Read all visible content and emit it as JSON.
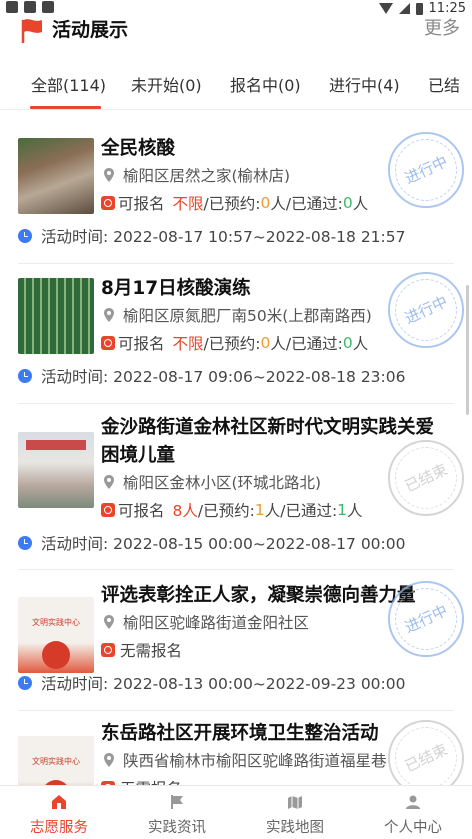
{
  "status_bar": {
    "time": "11:25"
  },
  "header": {
    "title": "活动展示",
    "more_label": "更多"
  },
  "tabs": [
    {
      "label": "全部(114)",
      "active": true
    },
    {
      "label": "未开始(0)",
      "active": false
    },
    {
      "label": "报名中(0)",
      "active": false
    },
    {
      "label": "进行中(4)",
      "active": false
    },
    {
      "label": "已结",
      "active": false
    }
  ],
  "activities": [
    {
      "title": "全民核酸",
      "location": "榆阳区居然之家(榆林店)",
      "reg_prefix": "可报名",
      "reg_limit": "不限",
      "reg_mid1": "/已预约: ",
      "reg_booked": "0",
      "reg_mid2": "人/已通过: ",
      "reg_passed": "0",
      "reg_suffix": "人",
      "time": "活动时间: 2022-08-17 10:57~2022-08-18 21:57",
      "stamp": "进行中"
    },
    {
      "title": "8月17日核酸演练",
      "location": "榆阳区原氮肥厂南50米(上郡南路西)",
      "reg_prefix": "可报名",
      "reg_limit": "不限",
      "reg_mid1": "/已预约: ",
      "reg_booked": "0",
      "reg_mid2": "人/已通过: ",
      "reg_passed": "0",
      "reg_suffix": "人",
      "time": "活动时间: 2022-08-17 09:06~2022-08-18 23:06",
      "stamp": "进行中"
    },
    {
      "title": "金沙路街道金林社区新时代文明实践关爱困境儿童",
      "location": "榆阳区金林小区(环城北路北)",
      "reg_prefix": "可报名",
      "reg_limit": "8人",
      "reg_mid1": "/已预约: ",
      "reg_booked": "1",
      "reg_mid2": "人/已通过: ",
      "reg_passed": "1",
      "reg_suffix": "人",
      "time": "活动时间: 2022-08-15 00:00~2022-08-17 00:00",
      "stamp": "已结束"
    },
    {
      "title": "评选表彰拴正人家，凝聚崇德向善力量",
      "location": "榆阳区驼峰路街道金阳社区",
      "reg_plain": "无需报名",
      "time": "活动时间: 2022-08-13 00:00~2022-09-23 00:00",
      "stamp": "进行中",
      "thumb_caption": "文明实践中心"
    },
    {
      "title": "东岳路社区开展环境卫生整治活动",
      "location": "陕西省榆林市榆阳区驼峰路街道福星巷",
      "reg_plain": "无需报名",
      "stamp": "已结束",
      "thumb_caption": "文明实践中心"
    }
  ],
  "bottom_nav": [
    {
      "label": "志愿服务",
      "active": true
    },
    {
      "label": "实践资讯",
      "active": false
    },
    {
      "label": "实践地图",
      "active": false
    },
    {
      "label": "个人中心",
      "active": false
    }
  ],
  "colors": {
    "accent": "#e8452c",
    "orange": "#f09a35",
    "green": "#3cb96b",
    "clock": "#3d7bf0",
    "stamp_blue": "#7ea6e6"
  }
}
